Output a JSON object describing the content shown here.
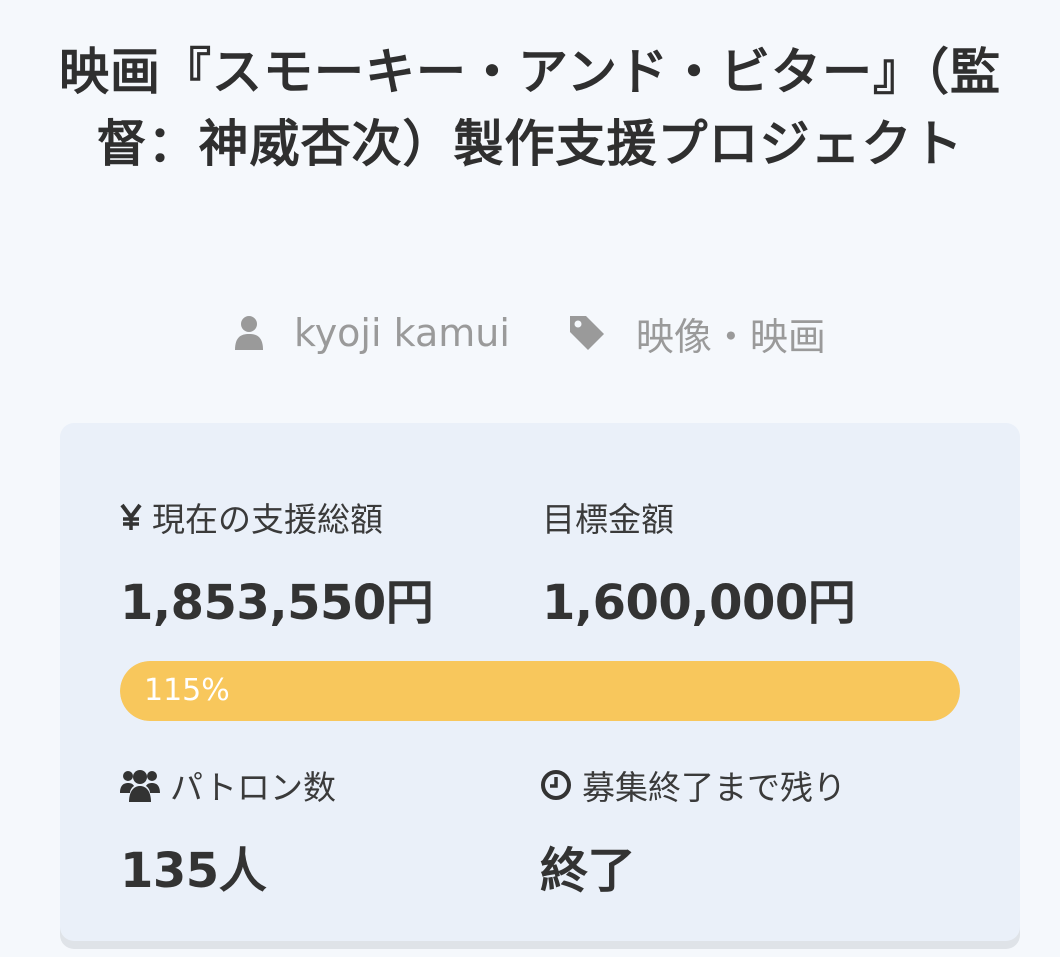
{
  "project": {
    "title": "映画『スモーキー・アンド・ビター』（監督：神威杏次）製作支援プロジェクト",
    "author": "kyoji kamui",
    "category": "映像・映画"
  },
  "icons": {
    "author": "user-icon",
    "category": "tag-icon",
    "raised": "yen-icon",
    "patrons": "users-icon",
    "remaining": "clock-icon"
  },
  "stats": {
    "raised_label": "現在の支援総額",
    "raised_value": "1,853,550円",
    "goal_label": "目標金額",
    "goal_value": "1,600,000円",
    "progress_text": "115%",
    "progress_fraction": 1.0,
    "patrons_label": "パトロン数",
    "patrons_value": "135人",
    "remaining_label": "募集終了まで残り",
    "remaining_value": "終了"
  },
  "colors": {
    "progress": "#f8c75c",
    "card": "#eaf0f9",
    "muted": "#9a9a9a"
  }
}
